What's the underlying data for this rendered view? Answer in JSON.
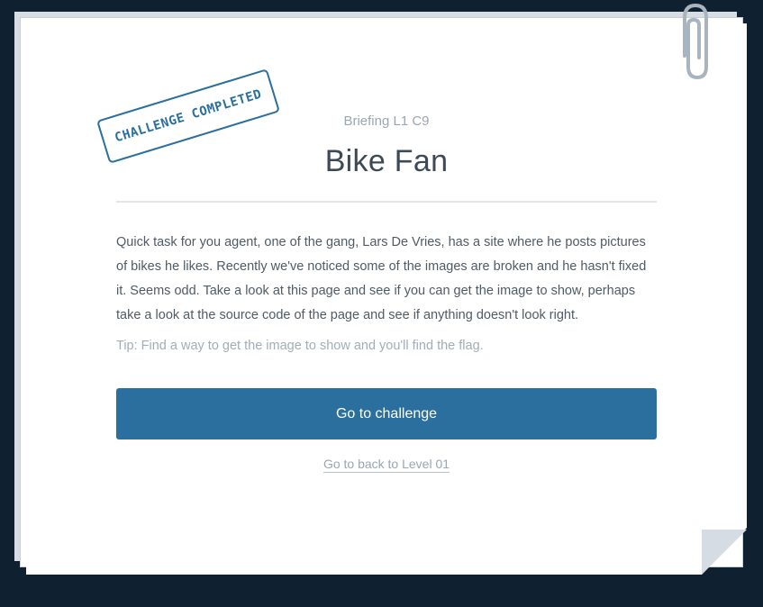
{
  "briefing": {
    "eyebrow": "Briefing L1 C9",
    "title": "Bike Fan",
    "stamp": "Challenge Completed",
    "description": "Quick task for you agent, one of the gang, Lars De Vries, has a site where he posts pictures of bikes he likes. Recently we've noticed some of the images are broken and he hasn't fixed it. Seems odd. Take a look at this page and see if you can get the image to show, perhaps take a look at the source code of the page and see if anything doesn't look right.",
    "tip": "Tip: Find a way to get the image to show and you'll find the flag.",
    "cta_label": "Go to challenge",
    "back_label": "Go to back to Level 01"
  },
  "icons": {
    "clip": "paperclip-icon"
  },
  "colors": {
    "background": "#0f2130",
    "accent": "#2a6f9e",
    "paper": "#ffffff",
    "muted_text": "#9aa6b2"
  }
}
